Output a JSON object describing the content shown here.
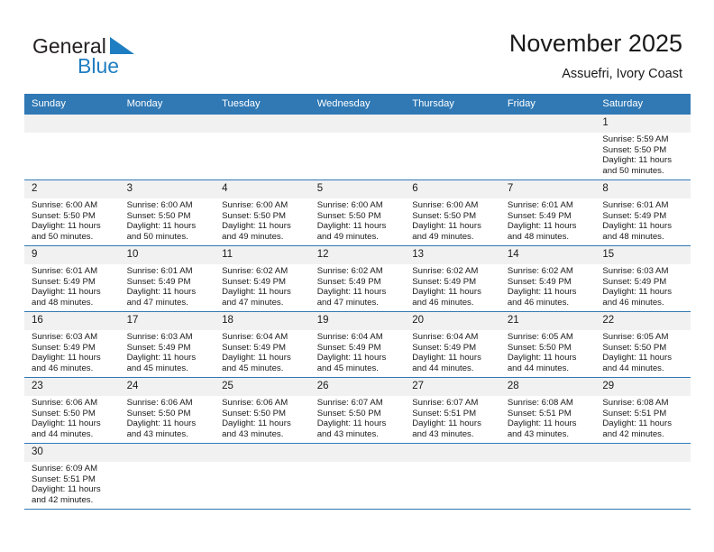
{
  "brand": {
    "name_part1": "General",
    "name_part2": "Blue",
    "flag_icon": "blue-triangle-flag-icon",
    "accent_color": "#1f7ec1"
  },
  "header": {
    "title": "November 2025",
    "subtitle": "Assuefri, Ivory Coast"
  },
  "theme": {
    "header_bg": "#3079b5",
    "daynum_bg": "#f1f1f1",
    "grid_line": "#3079b5",
    "text": "#1a1a1a"
  },
  "calendar": {
    "weekday_headers": [
      "Sunday",
      "Monday",
      "Tuesday",
      "Wednesday",
      "Thursday",
      "Friday",
      "Saturday"
    ],
    "weeks": [
      [
        {
          "day": "",
          "sunrise": "",
          "sunset": "",
          "daylight_line1": "",
          "daylight_line2": ""
        },
        {
          "day": "",
          "sunrise": "",
          "sunset": "",
          "daylight_line1": "",
          "daylight_line2": ""
        },
        {
          "day": "",
          "sunrise": "",
          "sunset": "",
          "daylight_line1": "",
          "daylight_line2": ""
        },
        {
          "day": "",
          "sunrise": "",
          "sunset": "",
          "daylight_line1": "",
          "daylight_line2": ""
        },
        {
          "day": "",
          "sunrise": "",
          "sunset": "",
          "daylight_line1": "",
          "daylight_line2": ""
        },
        {
          "day": "",
          "sunrise": "",
          "sunset": "",
          "daylight_line1": "",
          "daylight_line2": ""
        },
        {
          "day": "1",
          "sunrise": "Sunrise: 5:59 AM",
          "sunset": "Sunset: 5:50 PM",
          "daylight_line1": "Daylight: 11 hours",
          "daylight_line2": "and 50 minutes."
        }
      ],
      [
        {
          "day": "2",
          "sunrise": "Sunrise: 6:00 AM",
          "sunset": "Sunset: 5:50 PM",
          "daylight_line1": "Daylight: 11 hours",
          "daylight_line2": "and 50 minutes."
        },
        {
          "day": "3",
          "sunrise": "Sunrise: 6:00 AM",
          "sunset": "Sunset: 5:50 PM",
          "daylight_line1": "Daylight: 11 hours",
          "daylight_line2": "and 50 minutes."
        },
        {
          "day": "4",
          "sunrise": "Sunrise: 6:00 AM",
          "sunset": "Sunset: 5:50 PM",
          "daylight_line1": "Daylight: 11 hours",
          "daylight_line2": "and 49 minutes."
        },
        {
          "day": "5",
          "sunrise": "Sunrise: 6:00 AM",
          "sunset": "Sunset: 5:50 PM",
          "daylight_line1": "Daylight: 11 hours",
          "daylight_line2": "and 49 minutes."
        },
        {
          "day": "6",
          "sunrise": "Sunrise: 6:00 AM",
          "sunset": "Sunset: 5:50 PM",
          "daylight_line1": "Daylight: 11 hours",
          "daylight_line2": "and 49 minutes."
        },
        {
          "day": "7",
          "sunrise": "Sunrise: 6:01 AM",
          "sunset": "Sunset: 5:49 PM",
          "daylight_line1": "Daylight: 11 hours",
          "daylight_line2": "and 48 minutes."
        },
        {
          "day": "8",
          "sunrise": "Sunrise: 6:01 AM",
          "sunset": "Sunset: 5:49 PM",
          "daylight_line1": "Daylight: 11 hours",
          "daylight_line2": "and 48 minutes."
        }
      ],
      [
        {
          "day": "9",
          "sunrise": "Sunrise: 6:01 AM",
          "sunset": "Sunset: 5:49 PM",
          "daylight_line1": "Daylight: 11 hours",
          "daylight_line2": "and 48 minutes."
        },
        {
          "day": "10",
          "sunrise": "Sunrise: 6:01 AM",
          "sunset": "Sunset: 5:49 PM",
          "daylight_line1": "Daylight: 11 hours",
          "daylight_line2": "and 47 minutes."
        },
        {
          "day": "11",
          "sunrise": "Sunrise: 6:02 AM",
          "sunset": "Sunset: 5:49 PM",
          "daylight_line1": "Daylight: 11 hours",
          "daylight_line2": "and 47 minutes."
        },
        {
          "day": "12",
          "sunrise": "Sunrise: 6:02 AM",
          "sunset": "Sunset: 5:49 PM",
          "daylight_line1": "Daylight: 11 hours",
          "daylight_line2": "and 47 minutes."
        },
        {
          "day": "13",
          "sunrise": "Sunrise: 6:02 AM",
          "sunset": "Sunset: 5:49 PM",
          "daylight_line1": "Daylight: 11 hours",
          "daylight_line2": "and 46 minutes."
        },
        {
          "day": "14",
          "sunrise": "Sunrise: 6:02 AM",
          "sunset": "Sunset: 5:49 PM",
          "daylight_line1": "Daylight: 11 hours",
          "daylight_line2": "and 46 minutes."
        },
        {
          "day": "15",
          "sunrise": "Sunrise: 6:03 AM",
          "sunset": "Sunset: 5:49 PM",
          "daylight_line1": "Daylight: 11 hours",
          "daylight_line2": "and 46 minutes."
        }
      ],
      [
        {
          "day": "16",
          "sunrise": "Sunrise: 6:03 AM",
          "sunset": "Sunset: 5:49 PM",
          "daylight_line1": "Daylight: 11 hours",
          "daylight_line2": "and 46 minutes."
        },
        {
          "day": "17",
          "sunrise": "Sunrise: 6:03 AM",
          "sunset": "Sunset: 5:49 PM",
          "daylight_line1": "Daylight: 11 hours",
          "daylight_line2": "and 45 minutes."
        },
        {
          "day": "18",
          "sunrise": "Sunrise: 6:04 AM",
          "sunset": "Sunset: 5:49 PM",
          "daylight_line1": "Daylight: 11 hours",
          "daylight_line2": "and 45 minutes."
        },
        {
          "day": "19",
          "sunrise": "Sunrise: 6:04 AM",
          "sunset": "Sunset: 5:49 PM",
          "daylight_line1": "Daylight: 11 hours",
          "daylight_line2": "and 45 minutes."
        },
        {
          "day": "20",
          "sunrise": "Sunrise: 6:04 AM",
          "sunset": "Sunset: 5:49 PM",
          "daylight_line1": "Daylight: 11 hours",
          "daylight_line2": "and 44 minutes."
        },
        {
          "day": "21",
          "sunrise": "Sunrise: 6:05 AM",
          "sunset": "Sunset: 5:50 PM",
          "daylight_line1": "Daylight: 11 hours",
          "daylight_line2": "and 44 minutes."
        },
        {
          "day": "22",
          "sunrise": "Sunrise: 6:05 AM",
          "sunset": "Sunset: 5:50 PM",
          "daylight_line1": "Daylight: 11 hours",
          "daylight_line2": "and 44 minutes."
        }
      ],
      [
        {
          "day": "23",
          "sunrise": "Sunrise: 6:06 AM",
          "sunset": "Sunset: 5:50 PM",
          "daylight_line1": "Daylight: 11 hours",
          "daylight_line2": "and 44 minutes."
        },
        {
          "day": "24",
          "sunrise": "Sunrise: 6:06 AM",
          "sunset": "Sunset: 5:50 PM",
          "daylight_line1": "Daylight: 11 hours",
          "daylight_line2": "and 43 minutes."
        },
        {
          "day": "25",
          "sunrise": "Sunrise: 6:06 AM",
          "sunset": "Sunset: 5:50 PM",
          "daylight_line1": "Daylight: 11 hours",
          "daylight_line2": "and 43 minutes."
        },
        {
          "day": "26",
          "sunrise": "Sunrise: 6:07 AM",
          "sunset": "Sunset: 5:50 PM",
          "daylight_line1": "Daylight: 11 hours",
          "daylight_line2": "and 43 minutes."
        },
        {
          "day": "27",
          "sunrise": "Sunrise: 6:07 AM",
          "sunset": "Sunset: 5:51 PM",
          "daylight_line1": "Daylight: 11 hours",
          "daylight_line2": "and 43 minutes."
        },
        {
          "day": "28",
          "sunrise": "Sunrise: 6:08 AM",
          "sunset": "Sunset: 5:51 PM",
          "daylight_line1": "Daylight: 11 hours",
          "daylight_line2": "and 43 minutes."
        },
        {
          "day": "29",
          "sunrise": "Sunrise: 6:08 AM",
          "sunset": "Sunset: 5:51 PM",
          "daylight_line1": "Daylight: 11 hours",
          "daylight_line2": "and 42 minutes."
        }
      ],
      [
        {
          "day": "30",
          "sunrise": "Sunrise: 6:09 AM",
          "sunset": "Sunset: 5:51 PM",
          "daylight_line1": "Daylight: 11 hours",
          "daylight_line2": "and 42 minutes."
        },
        {
          "day": "",
          "sunrise": "",
          "sunset": "",
          "daylight_line1": "",
          "daylight_line2": ""
        },
        {
          "day": "",
          "sunrise": "",
          "sunset": "",
          "daylight_line1": "",
          "daylight_line2": ""
        },
        {
          "day": "",
          "sunrise": "",
          "sunset": "",
          "daylight_line1": "",
          "daylight_line2": ""
        },
        {
          "day": "",
          "sunrise": "",
          "sunset": "",
          "daylight_line1": "",
          "daylight_line2": ""
        },
        {
          "day": "",
          "sunrise": "",
          "sunset": "",
          "daylight_line1": "",
          "daylight_line2": ""
        },
        {
          "day": "",
          "sunrise": "",
          "sunset": "",
          "daylight_line1": "",
          "daylight_line2": ""
        }
      ]
    ]
  }
}
